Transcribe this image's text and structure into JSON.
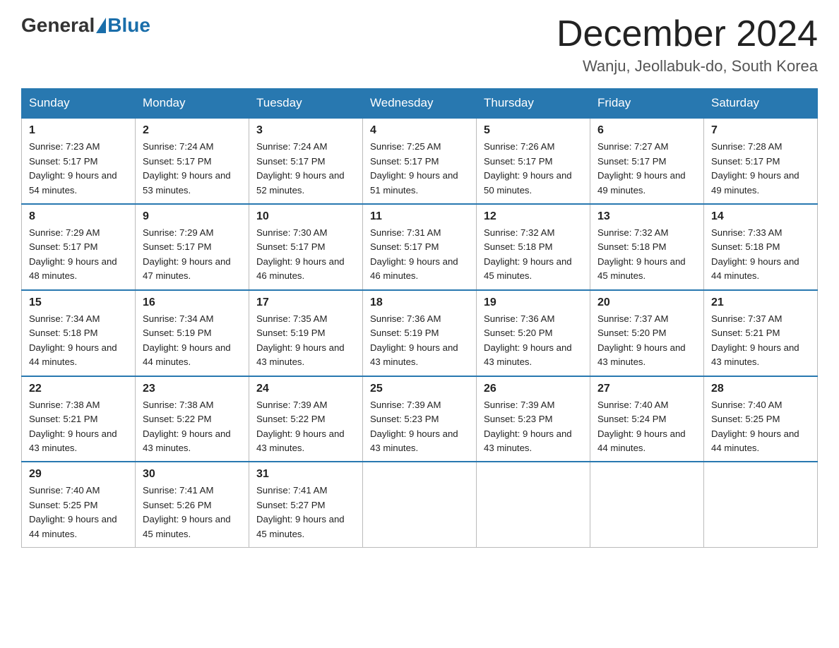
{
  "header": {
    "logo_general": "General",
    "logo_blue": "Blue",
    "month_title": "December 2024",
    "location": "Wanju, Jeollabuk-do, South Korea"
  },
  "weekdays": [
    "Sunday",
    "Monday",
    "Tuesday",
    "Wednesday",
    "Thursday",
    "Friday",
    "Saturday"
  ],
  "weeks": [
    [
      {
        "day": "1",
        "sunrise": "7:23 AM",
        "sunset": "5:17 PM",
        "daylight": "9 hours and 54 minutes."
      },
      {
        "day": "2",
        "sunrise": "7:24 AM",
        "sunset": "5:17 PM",
        "daylight": "9 hours and 53 minutes."
      },
      {
        "day": "3",
        "sunrise": "7:24 AM",
        "sunset": "5:17 PM",
        "daylight": "9 hours and 52 minutes."
      },
      {
        "day": "4",
        "sunrise": "7:25 AM",
        "sunset": "5:17 PM",
        "daylight": "9 hours and 51 minutes."
      },
      {
        "day": "5",
        "sunrise": "7:26 AM",
        "sunset": "5:17 PM",
        "daylight": "9 hours and 50 minutes."
      },
      {
        "day": "6",
        "sunrise": "7:27 AM",
        "sunset": "5:17 PM",
        "daylight": "9 hours and 49 minutes."
      },
      {
        "day": "7",
        "sunrise": "7:28 AM",
        "sunset": "5:17 PM",
        "daylight": "9 hours and 49 minutes."
      }
    ],
    [
      {
        "day": "8",
        "sunrise": "7:29 AM",
        "sunset": "5:17 PM",
        "daylight": "9 hours and 48 minutes."
      },
      {
        "day": "9",
        "sunrise": "7:29 AM",
        "sunset": "5:17 PM",
        "daylight": "9 hours and 47 minutes."
      },
      {
        "day": "10",
        "sunrise": "7:30 AM",
        "sunset": "5:17 PM",
        "daylight": "9 hours and 46 minutes."
      },
      {
        "day": "11",
        "sunrise": "7:31 AM",
        "sunset": "5:17 PM",
        "daylight": "9 hours and 46 minutes."
      },
      {
        "day": "12",
        "sunrise": "7:32 AM",
        "sunset": "5:18 PM",
        "daylight": "9 hours and 45 minutes."
      },
      {
        "day": "13",
        "sunrise": "7:32 AM",
        "sunset": "5:18 PM",
        "daylight": "9 hours and 45 minutes."
      },
      {
        "day": "14",
        "sunrise": "7:33 AM",
        "sunset": "5:18 PM",
        "daylight": "9 hours and 44 minutes."
      }
    ],
    [
      {
        "day": "15",
        "sunrise": "7:34 AM",
        "sunset": "5:18 PM",
        "daylight": "9 hours and 44 minutes."
      },
      {
        "day": "16",
        "sunrise": "7:34 AM",
        "sunset": "5:19 PM",
        "daylight": "9 hours and 44 minutes."
      },
      {
        "day": "17",
        "sunrise": "7:35 AM",
        "sunset": "5:19 PM",
        "daylight": "9 hours and 43 minutes."
      },
      {
        "day": "18",
        "sunrise": "7:36 AM",
        "sunset": "5:19 PM",
        "daylight": "9 hours and 43 minutes."
      },
      {
        "day": "19",
        "sunrise": "7:36 AM",
        "sunset": "5:20 PM",
        "daylight": "9 hours and 43 minutes."
      },
      {
        "day": "20",
        "sunrise": "7:37 AM",
        "sunset": "5:20 PM",
        "daylight": "9 hours and 43 minutes."
      },
      {
        "day": "21",
        "sunrise": "7:37 AM",
        "sunset": "5:21 PM",
        "daylight": "9 hours and 43 minutes."
      }
    ],
    [
      {
        "day": "22",
        "sunrise": "7:38 AM",
        "sunset": "5:21 PM",
        "daylight": "9 hours and 43 minutes."
      },
      {
        "day": "23",
        "sunrise": "7:38 AM",
        "sunset": "5:22 PM",
        "daylight": "9 hours and 43 minutes."
      },
      {
        "day": "24",
        "sunrise": "7:39 AM",
        "sunset": "5:22 PM",
        "daylight": "9 hours and 43 minutes."
      },
      {
        "day": "25",
        "sunrise": "7:39 AM",
        "sunset": "5:23 PM",
        "daylight": "9 hours and 43 minutes."
      },
      {
        "day": "26",
        "sunrise": "7:39 AM",
        "sunset": "5:23 PM",
        "daylight": "9 hours and 43 minutes."
      },
      {
        "day": "27",
        "sunrise": "7:40 AM",
        "sunset": "5:24 PM",
        "daylight": "9 hours and 44 minutes."
      },
      {
        "day": "28",
        "sunrise": "7:40 AM",
        "sunset": "5:25 PM",
        "daylight": "9 hours and 44 minutes."
      }
    ],
    [
      {
        "day": "29",
        "sunrise": "7:40 AM",
        "sunset": "5:25 PM",
        "daylight": "9 hours and 44 minutes."
      },
      {
        "day": "30",
        "sunrise": "7:41 AM",
        "sunset": "5:26 PM",
        "daylight": "9 hours and 45 minutes."
      },
      {
        "day": "31",
        "sunrise": "7:41 AM",
        "sunset": "5:27 PM",
        "daylight": "9 hours and 45 minutes."
      },
      null,
      null,
      null,
      null
    ]
  ]
}
